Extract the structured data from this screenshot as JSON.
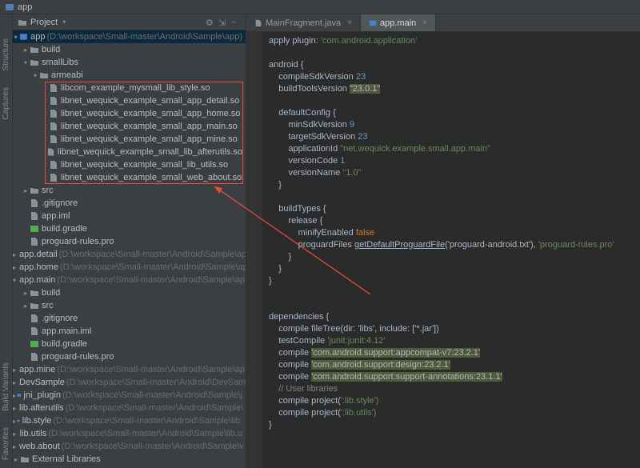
{
  "breadcrumb": {
    "label": "app"
  },
  "panel": {
    "title": "Project",
    "gear": "⚙",
    "collapse": "⇲",
    "hide": "−"
  },
  "toolwindows": {
    "structure": "Structure",
    "captures": "Captures",
    "build_variants": "Build Variants",
    "favorites": "Favorites"
  },
  "tabs": [
    {
      "label": "MainFragment.java",
      "active": false
    },
    {
      "label": "app.main",
      "active": true
    }
  ],
  "tree": {
    "root": {
      "label": "app",
      "path": "(D:\\workspace\\Small-master\\Android\\Sample\\app)"
    },
    "build": "build",
    "smalllibs": "smallLibs",
    "armeabi": "armeabi",
    "sofiles": [
      "libcom_example_mysmall_lib_style.so",
      "libnet_wequick_example_small_app_detail.so",
      "libnet_wequick_example_small_app_home.so",
      "libnet_wequick_example_small_app_main.so",
      "libnet_wequick_example_small_app_mine.so",
      "libnet_wequick_example_small_lib_afterutils.so",
      "libnet_wequick_example_small_lib_utils.so",
      "libnet_wequick_example_small_web_about.so"
    ],
    "src": "src",
    "gitignore": ".gitignore",
    "appiml": "app.iml",
    "buildgradle": "build.gradle",
    "proguard": "proguard-rules.pro",
    "appdetail": {
      "label": "app.detail",
      "path": "(D:\\workspace\\Small-master\\Android\\Sample\\ap"
    },
    "apphome": {
      "label": "app.home",
      "path": "(D:\\workspace\\Small-master\\Android\\Sample\\ap"
    },
    "appmain": {
      "label": "app.main",
      "path": "(D:\\workspace\\Small-master\\Android\\Sample\\ap"
    },
    "appmain_children": {
      "build": "build",
      "src": "src",
      "gitignore": ".gitignore",
      "iml": "app.main.iml",
      "buildgradle": "build.gradle",
      "proguard": "proguard-rules.pro"
    },
    "appmine": {
      "label": "app.mine",
      "path": "(D:\\workspace\\Small-master\\Android\\Sample\\ap"
    },
    "devsample": {
      "label": "DevSample",
      "path": "(D:\\workspace\\Small-master\\Android\\DevSam"
    },
    "jniplugin": {
      "label": "jni_plugin",
      "path": "(D:\\workspace\\Small-master\\Android\\Sample\\j"
    },
    "libafter": {
      "label": "lib.afterutils",
      "path": "(D:\\workspace\\Small-master\\Android\\Sample\\"
    },
    "libstyle": {
      "label": "lib.style",
      "path": "(D:\\workspace\\Small-master\\Android\\Sample\\lib."
    },
    "libutils": {
      "label": "lib.utils",
      "path": "(D:\\workspace\\Small-master\\Android\\Sample\\lib.u"
    },
    "webabout": {
      "label": "web.about",
      "path": "(D:\\workspace\\Small-master\\Android\\Sample\\v"
    },
    "extlibs": "External Libraries"
  },
  "code": {
    "apply": "apply plugin: ",
    "apply_val": "'com.android.application'",
    "android": "android {",
    "compileSdk": "    compileSdkVersion ",
    "compileSdk_v": "23",
    "buildTools": "    buildToolsVersion ",
    "buildTools_v": "\"23.0.1\"",
    "defaultConfig": "    defaultConfig {",
    "minSdk": "        minSdkVersion ",
    "minSdk_v": "9",
    "targetSdk": "        targetSdkVersion ",
    "targetSdk_v": "23",
    "appId": "        applicationId ",
    "appId_v": "\"net.wequick.example.small.app.main\"",
    "versionCode": "        versionCode ",
    "versionCode_v": "1",
    "versionName": "        versionName ",
    "versionName_v": "\"1.0\"",
    "close1": "    }",
    "buildTypes": "    buildTypes {",
    "release": "        release {",
    "minify": "            minifyEnabled ",
    "minify_v": "false",
    "proguard": "            proguardFiles ",
    "proguard_call": "getDefaultProguardFile",
    "proguard_arg1": "('proguard-android.txt'), ",
    "proguard_arg2": "'proguard-rules.pro'",
    "close2": "        }",
    "close3": "    }",
    "close4": "}",
    "deps": "dependencies {",
    "fileTree": "    compile fileTree(",
    "fileTree_args": "dir: 'libs', include: ['*.jar'])",
    "testCompile": "    testCompile ",
    "testCompile_v": "'junit:junit:4.12'",
    "compile1": "    compile ",
    "compile1_v": "'com.android.support:appcompat-v7:23.2.1'",
    "compile2": "    compile ",
    "compile2_v": "'com.android.support:design:23.2.1'",
    "compile3": "    compile ",
    "compile3_v": "'com.android.support:support-annotations:23.1.1'",
    "userlibs": "    // User libraries",
    "cproj1": "    compile project(",
    "cproj1_v": "':lib.style')",
    "cproj2": "    compile project(",
    "cproj2_v": "':lib.utils')",
    "close5": "}"
  }
}
